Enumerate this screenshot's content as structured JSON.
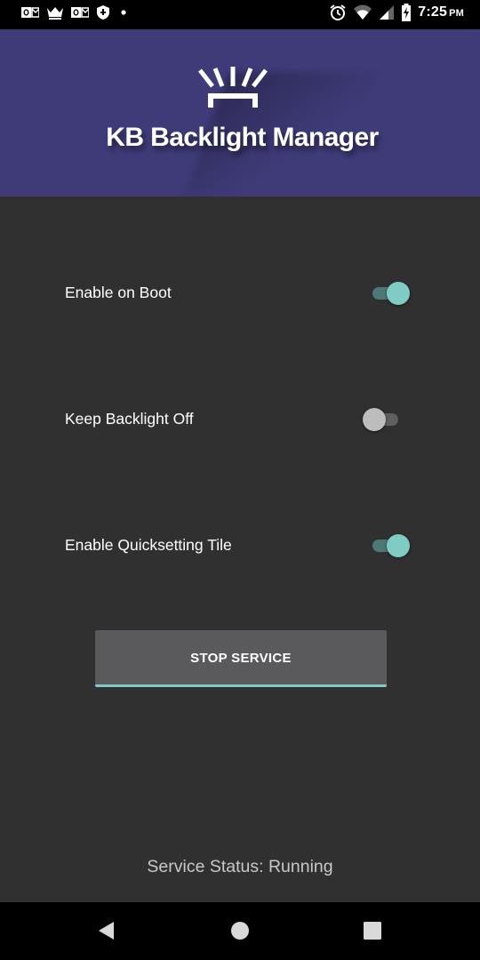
{
  "status_bar": {
    "time": "7:25",
    "ampm": "PM",
    "left_icons": [
      "outlook-icon",
      "crown-icon",
      "outlook-icon",
      "shield-icon",
      "dot-icon"
    ],
    "right_icons": [
      "alarm-icon",
      "wifi-icon",
      "signal-icon",
      "battery-charging-icon"
    ]
  },
  "header": {
    "title": "KB Backlight Manager",
    "logo_icon": "keyboard-backlight-icon",
    "background_color": "#3f3b79"
  },
  "settings": [
    {
      "label": "Enable on Boot",
      "enabled": true
    },
    {
      "label": "Keep Backlight Off",
      "enabled": false
    },
    {
      "label": "Enable Quicksetting Tile",
      "enabled": true
    }
  ],
  "button": {
    "label": "STOP SERVICE"
  },
  "service_status": {
    "text": "Service Status: Running"
  },
  "nav_bar": {
    "items": [
      "back-icon",
      "home-icon",
      "recents-icon"
    ]
  },
  "colors": {
    "background": "#303030",
    "accent": "#80cbc4",
    "toggle_on_track": "#4d7875",
    "toggle_off_thumb": "#bdbdbd",
    "button_bg": "#5a5a5c"
  }
}
